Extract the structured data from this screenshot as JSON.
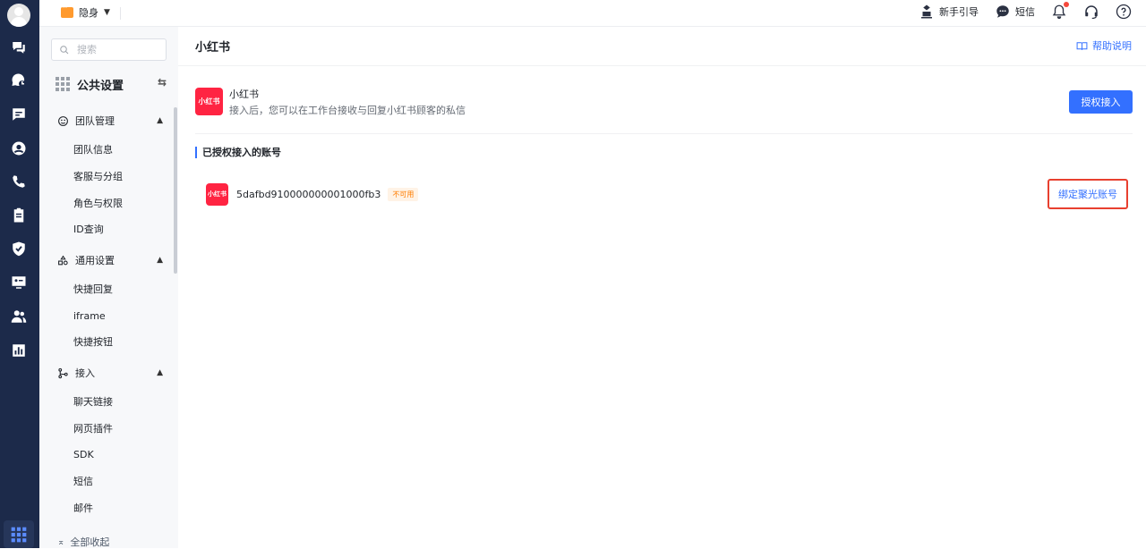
{
  "topbar": {
    "status_label": "隐身",
    "guide_label": "新手引导",
    "sms_label": "短信"
  },
  "sidebar": {
    "search_placeholder": "搜索",
    "title": "公共设置",
    "groups": [
      {
        "label": "团队管理",
        "items": [
          "团队信息",
          "客服与分组",
          "角色与权限",
          "ID查询"
        ]
      },
      {
        "label": "通用设置",
        "items": [
          "快捷回复",
          "iframe",
          "快捷按钮"
        ]
      },
      {
        "label": "接入",
        "items": [
          "聊天链接",
          "网页插件",
          "SDK",
          "短信",
          "邮件"
        ]
      }
    ],
    "collapse_all": "全部收起"
  },
  "main": {
    "page_title": "小红书",
    "help_label": "帮助说明",
    "channel": {
      "logo_text": "小红书",
      "name": "小红书",
      "description": "接入后，您可以在工作台接收与回复小红书顾客的私信",
      "auth_button": "授权接入"
    },
    "section_title": "已授权接入的账号",
    "account": {
      "logo_text": "小红书",
      "id": "5dafbd910000000001000fb3",
      "tag": "不可用",
      "bind_label": "绑定聚光账号"
    }
  },
  "colors": {
    "rail_bg": "#1c2a4a",
    "primary": "#3370ff",
    "brand_red": "#ff2442",
    "highlight_border": "#e8402f",
    "tag_orange": "#ff7d00"
  }
}
